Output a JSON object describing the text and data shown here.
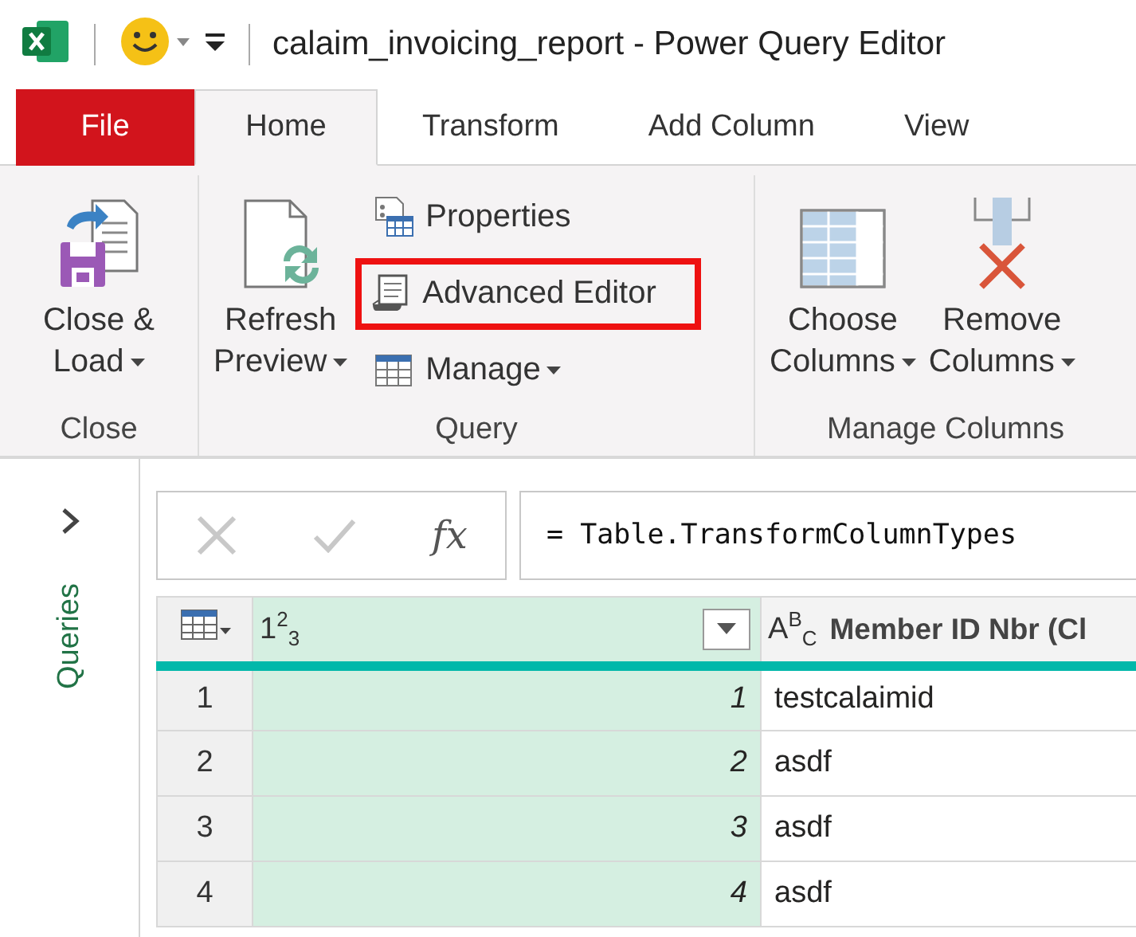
{
  "title_bar": {
    "title": "calaim_invoicing_report - Power Query Editor"
  },
  "tabs": [
    {
      "label": "File",
      "kind": "file",
      "selected": false
    },
    {
      "label": "Home",
      "kind": "tab",
      "selected": true
    },
    {
      "label": "Transform",
      "kind": "tab",
      "selected": false
    },
    {
      "label": "Add Column",
      "kind": "tab",
      "selected": false
    },
    {
      "label": "View",
      "kind": "tab",
      "selected": false
    }
  ],
  "ribbon": {
    "groups": [
      {
        "label": "Close",
        "buttons": [
          {
            "kind": "close-load",
            "lines": [
              "Close &",
              "Load"
            ],
            "dropdown": true
          }
        ]
      },
      {
        "label": "Query",
        "buttons": [
          {
            "kind": "refresh",
            "lines": [
              "Refresh",
              "Preview"
            ],
            "dropdown": true
          }
        ],
        "small_buttons": [
          {
            "kind": "properties",
            "label": "Properties",
            "dropdown": false
          },
          {
            "kind": "advanced-editor",
            "label": "Advanced Editor",
            "dropdown": false,
            "highlighted": true
          },
          {
            "kind": "manage",
            "label": "Manage",
            "dropdown": true
          }
        ]
      },
      {
        "label": "Manage Columns",
        "buttons": [
          {
            "kind": "choose-columns",
            "lines": [
              "Choose",
              "Columns"
            ],
            "dropdown": true
          },
          {
            "kind": "remove-columns",
            "lines": [
              "Remove",
              "Columns"
            ],
            "dropdown": true
          }
        ]
      }
    ]
  },
  "queries_pane": {
    "label": "Queries"
  },
  "formula_bar": {
    "fx_label": "fx",
    "formula": "= Table.TransformColumnTypes"
  },
  "table": {
    "columns": [
      {
        "kind": "number",
        "type_label": "1$^{2}$$_{3}$",
        "selected": true,
        "filter_button": true
      },
      {
        "kind": "text",
        "type_label": "A$^{B}$$_{C}$",
        "name": "Member ID Nbr (Cl",
        "selected": false
      }
    ],
    "rows": [
      {
        "number": "1",
        "cells": [
          "1",
          "testcalaimid"
        ]
      },
      {
        "number": "2",
        "cells": [
          "2",
          "asdf"
        ]
      },
      {
        "number": "3",
        "cells": [
          "3",
          "asdf"
        ]
      },
      {
        "number": "4",
        "cells": [
          "4",
          "asdf"
        ]
      }
    ]
  }
}
